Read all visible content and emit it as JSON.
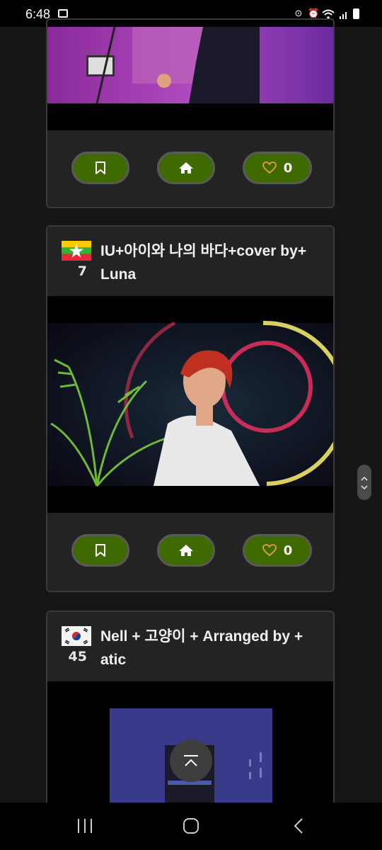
{
  "status_bar": {
    "time": "6:48"
  },
  "cards": [
    {
      "position": "top-partial",
      "like_count": "0"
    },
    {
      "flag": "Myanmar",
      "rank": "7",
      "title": "IU+아이와 나의 바다+cover by+ Luna",
      "like_count": "0"
    },
    {
      "flag": "South Korea",
      "rank": "45",
      "title": "Nell + 고양이 + Arranged by + atic"
    }
  ],
  "icons": {
    "bookmark": "bookmark-icon",
    "home": "home-icon",
    "heart": "heart-icon",
    "scroll_top": "chevron-up-icon",
    "nav_recents": "recents-icon",
    "nav_home": "home-circle-icon",
    "nav_back": "back-icon"
  },
  "colors": {
    "button_green": "#3f6a00",
    "heart_orange": "#e0a040",
    "card_bg": "#232323",
    "page_bg": "#161616"
  }
}
